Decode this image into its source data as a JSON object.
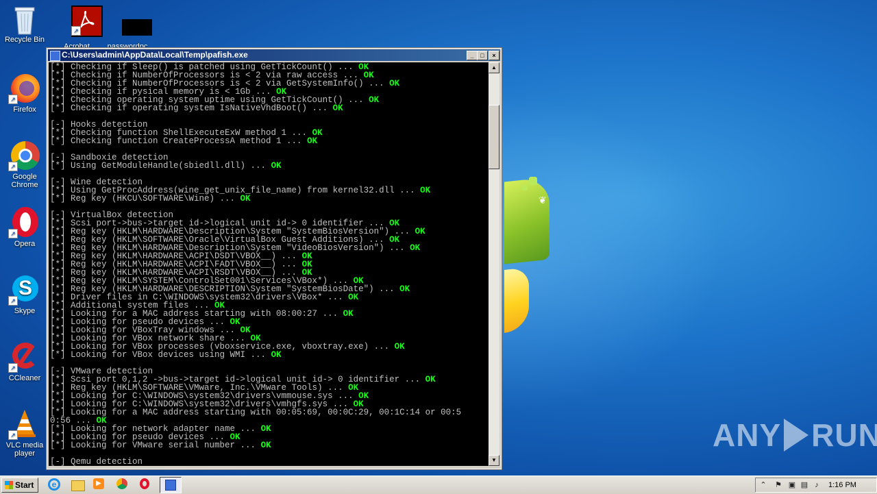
{
  "desktop": {
    "icons": [
      {
        "label": "Recycle Bin"
      },
      {
        "label": "Acrobat"
      },
      {
        "label": "passwordpc"
      },
      {
        "label": "Firefox"
      },
      {
        "label": "Google Chrome"
      },
      {
        "label": "Opera"
      },
      {
        "label": "Skype"
      },
      {
        "label": "CCleaner"
      },
      {
        "label": "VLC media player"
      }
    ]
  },
  "window": {
    "title": "C:\\Users\\admin\\AppData\\Local\\Temp\\pafish.exe",
    "buttons": {
      "minimize": "_",
      "maximize": "□",
      "close": "×"
    },
    "console_lines": [
      {
        "text": "[*] Checking if Sleep() is patched using GetTickCount() ... ",
        "status": "OK"
      },
      {
        "text": "[*] Checking if NumberOfProcessors is < 2 via raw access ... ",
        "status": "OK"
      },
      {
        "text": "[*] Checking if NumberOfProcessors is < 2 via GetSystemInfo() ... ",
        "status": "OK"
      },
      {
        "text": "[*] Checking if pysical memory is < 1Gb ... ",
        "status": "OK"
      },
      {
        "text": "[*] Checking operating system uptime using GetTickCount() ... ",
        "status": "OK"
      },
      {
        "text": "[*] Checking if operating system IsNativeVhdBoot() ... ",
        "status": "OK"
      },
      {
        "text": "",
        "status": ""
      },
      {
        "text": "[-] Hooks detection",
        "status": ""
      },
      {
        "text": "[*] Checking function ShellExecuteExW method 1 ... ",
        "status": "OK"
      },
      {
        "text": "[*] Checking function CreateProcessA method 1 ... ",
        "status": "OK"
      },
      {
        "text": "",
        "status": ""
      },
      {
        "text": "[-] Sandboxie detection",
        "status": ""
      },
      {
        "text": "[*] Using GetModuleHandle(sbiedll.dll) ... ",
        "status": "OK"
      },
      {
        "text": "",
        "status": ""
      },
      {
        "text": "[-] Wine detection",
        "status": ""
      },
      {
        "text": "[*] Using GetProcAddress(wine_get_unix_file_name) from kernel32.dll ... ",
        "status": "OK"
      },
      {
        "text": "[*] Reg key (HKCU\\SOFTWARE\\Wine) ... ",
        "status": "OK"
      },
      {
        "text": "",
        "status": ""
      },
      {
        "text": "[-] VirtualBox detection",
        "status": ""
      },
      {
        "text": "[*] Scsi port->bus->target id->logical unit id-> 0 identifier ... ",
        "status": "OK"
      },
      {
        "text": "[*] Reg key (HKLM\\HARDWARE\\Description\\System \"SystemBiosVersion\") ... ",
        "status": "OK"
      },
      {
        "text": "[*] Reg key (HKLM\\SOFTWARE\\Oracle\\VirtualBox Guest Additions) ... ",
        "status": "OK"
      },
      {
        "text": "[*] Reg key (HKLM\\HARDWARE\\Description\\System \"VideoBiosVersion\") ... ",
        "status": "OK"
      },
      {
        "text": "[*] Reg key (HKLM\\HARDWARE\\ACPI\\DSDT\\VBOX__) ... ",
        "status": "OK"
      },
      {
        "text": "[*] Reg key (HKLM\\HARDWARE\\ACPI\\FADT\\VBOX__) ... ",
        "status": "OK"
      },
      {
        "text": "[*] Reg key (HKLM\\HARDWARE\\ACPI\\RSDT\\VBOX__) ... ",
        "status": "OK"
      },
      {
        "text": "[*] Reg key (HKLM\\SYSTEM\\ControlSet001\\Services\\VBox*) ... ",
        "status": "OK"
      },
      {
        "text": "[*] Reg key (HKLM\\HARDWARE\\DESCRIPTION\\System \"SystemBiosDate\") ... ",
        "status": "OK"
      },
      {
        "text": "[*] Driver files in C:\\WINDOWS\\system32\\drivers\\VBox* ... ",
        "status": "OK"
      },
      {
        "text": "[*] Additional system files ... ",
        "status": "OK"
      },
      {
        "text": "[*] Looking for a MAC address starting with 08:00:27 ... ",
        "status": "OK"
      },
      {
        "text": "[*] Looking for pseudo devices ... ",
        "status": "OK"
      },
      {
        "text": "[*] Looking for VBoxTray windows ... ",
        "status": "OK"
      },
      {
        "text": "[*] Looking for VBox network share ... ",
        "status": "OK"
      },
      {
        "text": "[*] Looking for VBox processes (vboxservice.exe, vboxtray.exe) ... ",
        "status": "OK"
      },
      {
        "text": "[*] Looking for VBox devices using WMI ... ",
        "status": "OK"
      },
      {
        "text": "",
        "status": ""
      },
      {
        "text": "[-] VMware detection",
        "status": ""
      },
      {
        "text": "[*] Scsi port 0,1,2 ->bus->target id->logical unit id-> 0 identifier ... ",
        "status": "OK"
      },
      {
        "text": "[*] Reg key (HKLM\\SOFTWARE\\VMware, Inc.\\VMware Tools) ... ",
        "status": "OK"
      },
      {
        "text": "[*] Looking for C:\\WINDOWS\\system32\\drivers\\vmmouse.sys ... ",
        "status": "OK"
      },
      {
        "text": "[*] Looking for C:\\WINDOWS\\system32\\drivers\\vmhgfs.sys ... ",
        "status": "OK"
      },
      {
        "text": "[*] Looking for a MAC address starting with 00:05:69, 00:0C:29, 00:1C:14 or 00:5",
        "status": ""
      },
      {
        "text": "0:56 ... ",
        "status": "OK"
      },
      {
        "text": "[*] Looking for network adapter name ... ",
        "status": "OK"
      },
      {
        "text": "[*] Looking for pseudo devices ... ",
        "status": "OK"
      },
      {
        "text": "[*] Looking for VMware serial number ... ",
        "status": "OK"
      },
      {
        "text": "",
        "status": ""
      },
      {
        "text": "[-] Qemu detection",
        "status": ""
      }
    ]
  },
  "taskbar": {
    "start_label": "Start",
    "clock": "1:16 PM"
  },
  "watermark": {
    "left": "ANY",
    "right": "RUN"
  },
  "colors": {
    "console_bg": "#000000",
    "console_text": "#c0c0c0",
    "ok": "#14ff14",
    "titlebar": "#0a246a"
  }
}
